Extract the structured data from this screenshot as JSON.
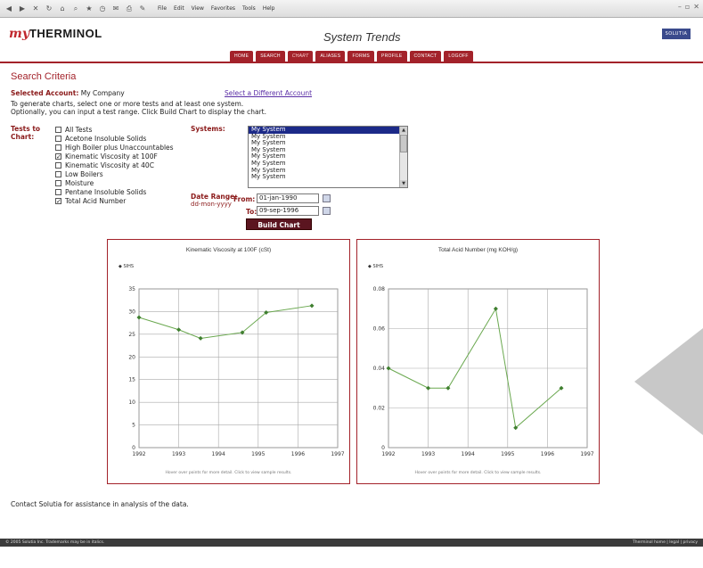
{
  "browser": {
    "menu": [
      "File",
      "Edit",
      "View",
      "Favorites",
      "Tools",
      "Help"
    ]
  },
  "header": {
    "logo_my": "my",
    "logo_main": "THERMINOL",
    "title": "System Trends",
    "brand": "SOLUTIA",
    "nav": [
      "HOME",
      "SEARCH",
      "CHART",
      "ALIASES",
      "FORMS",
      "PROFILE",
      "CONTACT",
      "LOGOFF"
    ],
    "active_nav": "CHART"
  },
  "search": {
    "title": "Search Criteria",
    "account_label": "Selected Account:",
    "account_value": "My Company",
    "change_account": "Select a Different Account",
    "instructions_1": "To generate charts, select one or more tests and at least one system.",
    "instructions_2": "Optionally, you can input a test range. Click Build Chart to display the chart.",
    "tests_label": "Tests to Chart:",
    "tests": [
      {
        "label": "All Tests",
        "checked": false
      },
      {
        "label": "Acetone Insoluble Solids",
        "checked": false
      },
      {
        "label": "High Boiler plus Unaccountables",
        "checked": false
      },
      {
        "label": "Kinematic Viscosity at 100F",
        "checked": true
      },
      {
        "label": "Kinematic Viscosity at 40C",
        "checked": false
      },
      {
        "label": "Low Boilers",
        "checked": false
      },
      {
        "label": "Moisture",
        "checked": false
      },
      {
        "label": "Pentane Insoluble Solids",
        "checked": false
      },
      {
        "label": "Total Acid Number",
        "checked": true
      }
    ],
    "systems_label": "Systems:",
    "systems": [
      "My System",
      "My System",
      "My System",
      "My System",
      "My System",
      "My System",
      "My System",
      "My System"
    ],
    "date_label": "Date Range:",
    "date_format": "dd-mon-yyyy",
    "from_label": "From:",
    "from_value": "01-jan-1990",
    "to_label": "To:",
    "to_value": "09-sep-1996",
    "build_button": "Build Chart"
  },
  "chart_data": [
    {
      "type": "line",
      "title": "Kinematic Viscosity at 100F (cSt)",
      "legend": "SIHS",
      "x": [
        1992.0,
        1993.0,
        1993.55,
        1994.6,
        1995.2,
        1996.35
      ],
      "y": [
        28.7,
        26.0,
        24.1,
        25.4,
        29.8,
        31.3
      ],
      "xlim": [
        1992,
        1997
      ],
      "ylim": [
        0,
        35
      ],
      "xticks": [
        1992,
        1993,
        1994,
        1995,
        1996,
        1997
      ],
      "yticks": [
        0,
        5,
        10,
        15,
        20,
        25,
        30,
        35
      ],
      "grid": true,
      "color": "#6aa84f",
      "footnote": "Hover over points for more detail. Click to view sample results."
    },
    {
      "type": "line",
      "title": "Total Acid Number (mg KOH/g)",
      "legend": "SIHS",
      "x": [
        1992.0,
        1993.0,
        1993.5,
        1994.7,
        1995.2,
        1996.35
      ],
      "y": [
        0.04,
        0.03,
        0.03,
        0.07,
        0.01,
        0.03
      ],
      "xlim": [
        1992,
        1997
      ],
      "ylim": [
        0,
        0.08
      ],
      "xticks": [
        1992,
        1993,
        1994,
        1995,
        1996,
        1997
      ],
      "yticks": [
        0,
        0.02,
        0.04,
        0.06,
        0.08
      ],
      "grid": true,
      "color": "#6aa84f",
      "footnote": "Hover over points for more detail. Click to view sample results."
    }
  ],
  "contact_text": "Contact Solutia for assistance in analysis of the data.",
  "footer": {
    "left": "© 2005 Solutia Inc. Trademarks may be in italics.",
    "right": "Therminol home | legal | privacy"
  }
}
